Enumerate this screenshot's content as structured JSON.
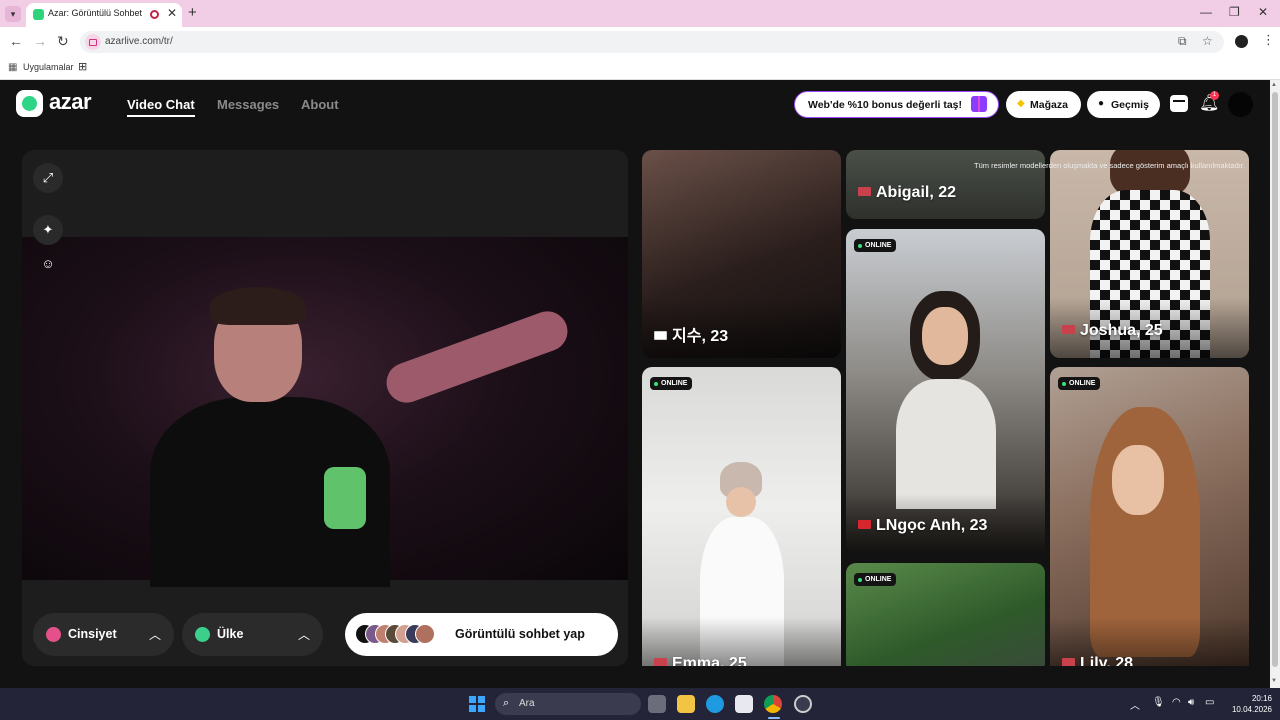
{
  "browser": {
    "tab_title": "Azar: Görüntülü Sohbet & Video Chat",
    "tab_close_glyph": "✕",
    "new_tab_glyph": "+",
    "url": "azarlive.com/tr/",
    "bookmark_label": "Uygulamalar"
  },
  "header": {
    "logo_text": "azar",
    "nav": [
      "Video Chat",
      "Messages",
      "About"
    ],
    "promo_text": "Web'de %10 bonus değerli taş!",
    "store_label": "Mağaza",
    "history_label": "Geçmiş",
    "notification_count": "1"
  },
  "video_panel": {
    "gender_filter_label": "Cinsiyet",
    "country_filter_label": "Ülke",
    "start_button_label": "Görüntülü sohbet yap"
  },
  "grid": {
    "disclaimer": "Tüm resimler modellerden oluşmakta ve sadece gösterim amaçlı kullanılmaktadır.",
    "online_label": "ONLINE",
    "profiles": [
      {
        "name": "지수, 23",
        "flag": "kr",
        "online": false
      },
      {
        "name": "Emma, 25",
        "flag": "us",
        "online": true
      },
      {
        "name": "Abigail, 22",
        "flag": "us",
        "online": false
      },
      {
        "name": "LNgọc Anh, 23",
        "flag": "vn",
        "online": true
      },
      {
        "name": "",
        "flag": "",
        "online": true
      },
      {
        "name": "Joshua, 25",
        "flag": "us",
        "online": false
      },
      {
        "name": "Lily, 28",
        "flag": "us",
        "online": true
      }
    ]
  },
  "taskbar": {
    "search_placeholder": "Ara",
    "time": "20:16",
    "date": "10.04.2026"
  },
  "colors": {
    "brand_green": "#2fd586",
    "promo_border": "#9a4bff",
    "online_dot": "#36e37d",
    "notification_badge": "#ff3553"
  }
}
